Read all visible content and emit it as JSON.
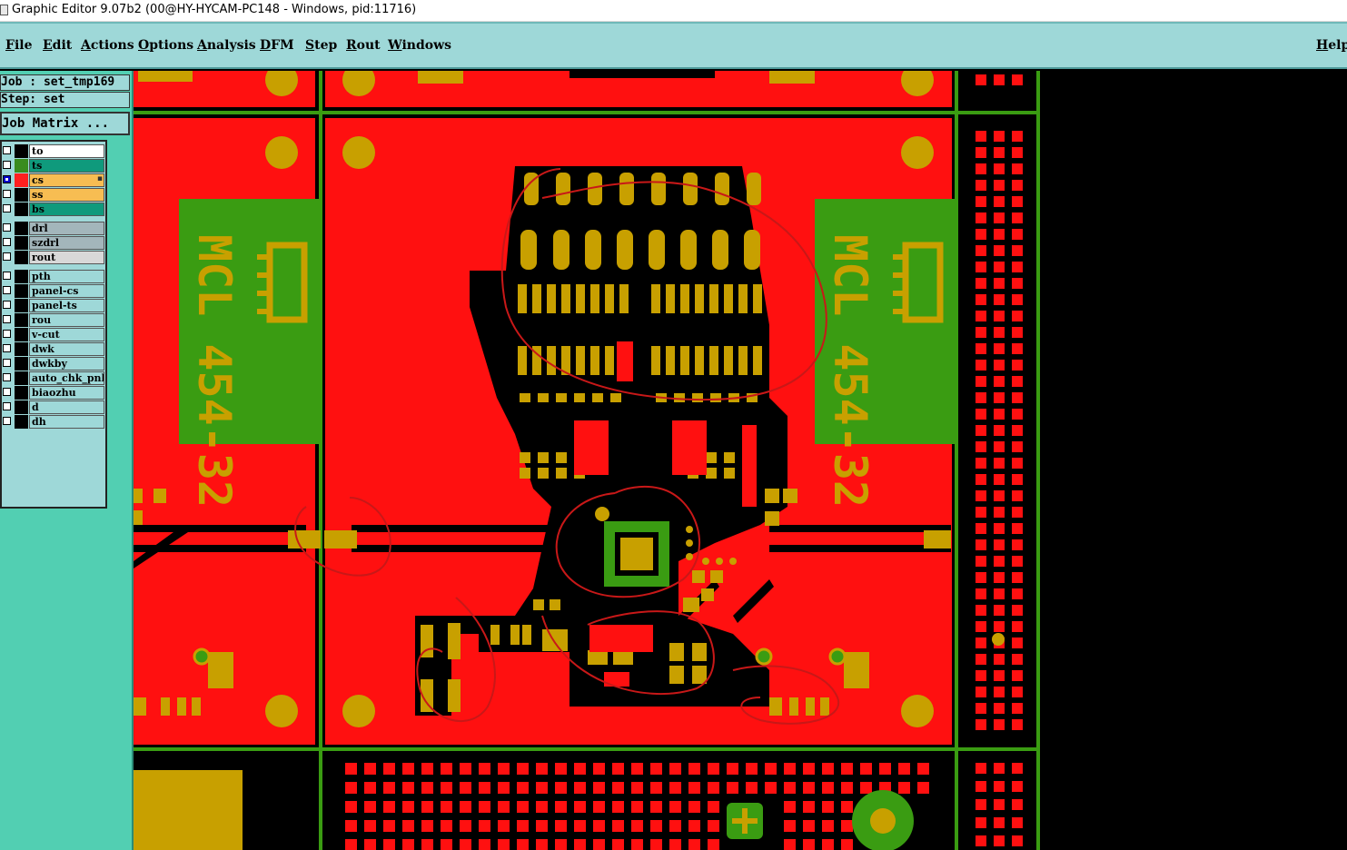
{
  "window": {
    "title": "Graphic Editor 9.07b2 (00@HY-HYCAM-PC148 - Windows, pid:11716)"
  },
  "menubar": {
    "items": [
      {
        "label": "File",
        "underline": "F",
        "rest": "ile"
      },
      {
        "label": "Edit",
        "underline": "E",
        "rest": "dit"
      },
      {
        "label": "Actions",
        "underline": "A",
        "rest": "ctions"
      },
      {
        "label": "Options",
        "underline": "O",
        "rest": "ptions"
      },
      {
        "label": "Analysis",
        "underline": "A",
        "rest": "nalysis"
      },
      {
        "label": "DFM",
        "underline": "D",
        "rest": "FM"
      },
      {
        "label": "Step",
        "underline": "S",
        "rest": "tep"
      },
      {
        "label": "Rout",
        "underline": "R",
        "rest": "out"
      },
      {
        "label": "Windows",
        "underline": "W",
        "rest": "indows"
      }
    ],
    "help": {
      "label": "Help",
      "underline": "H",
      "rest": "elp"
    }
  },
  "panel": {
    "job": "Job : set_tmp169",
    "step": "Step: set",
    "job_matrix": "Job Matrix ..."
  },
  "layers": [
    {
      "name": "to",
      "swatch": "#000000",
      "bg": "#ffffff"
    },
    {
      "name": "ts",
      "swatch": "#3a8c1e",
      "bg": "#0f9a7c"
    },
    {
      "name": "cs",
      "swatch": "#ff2020",
      "bg": "#f7bd52",
      "checked_color": "#0000cc",
      "indicator": true
    },
    {
      "name": "ss",
      "swatch": "#000000",
      "bg": "#f7bd52"
    },
    {
      "name": "bs",
      "swatch": "#000000",
      "bg": "#0f9a7c"
    },
    {
      "name": "drl",
      "swatch": "#000000",
      "bg": "#a3b6bb"
    },
    {
      "name": "szdrl",
      "swatch": "#000000",
      "bg": "#a3b6bb"
    },
    {
      "name": "rout",
      "swatch": "#000000",
      "bg": "#d8d8d8"
    },
    {
      "name": "pth",
      "swatch": "#000000",
      "bg": "#9ed8d8"
    },
    {
      "name": "panel-cs",
      "swatch": "#000000",
      "bg": "#9ed8d8"
    },
    {
      "name": "panel-ts",
      "swatch": "#000000",
      "bg": "#9ed8d8"
    },
    {
      "name": "rou",
      "swatch": "#000000",
      "bg": "#9ed8d8"
    },
    {
      "name": "v-cut",
      "swatch": "#000000",
      "bg": "#9ed8d8"
    },
    {
      "name": "dwk",
      "swatch": "#000000",
      "bg": "#9ed8d8"
    },
    {
      "name": "dwkby",
      "swatch": "#000000",
      "bg": "#9ed8d8"
    },
    {
      "name": "auto_chk_pnl",
      "swatch": "#000000",
      "bg": "#9ed8d8"
    },
    {
      "name": "biaozhu",
      "swatch": "#000000",
      "bg": "#9ed8d8"
    },
    {
      "name": "d",
      "swatch": "#000000",
      "bg": "#9ed8d8"
    },
    {
      "name": "dh",
      "swatch": "#000000",
      "bg": "#9ed8d8"
    }
  ],
  "board": {
    "copper_color": "#ff1010",
    "pad_color": "#c8a000",
    "mask_color": "#3a9c12",
    "silk_text_left": "MCL 454-32",
    "silk_text_right": "MCL 454-32"
  }
}
